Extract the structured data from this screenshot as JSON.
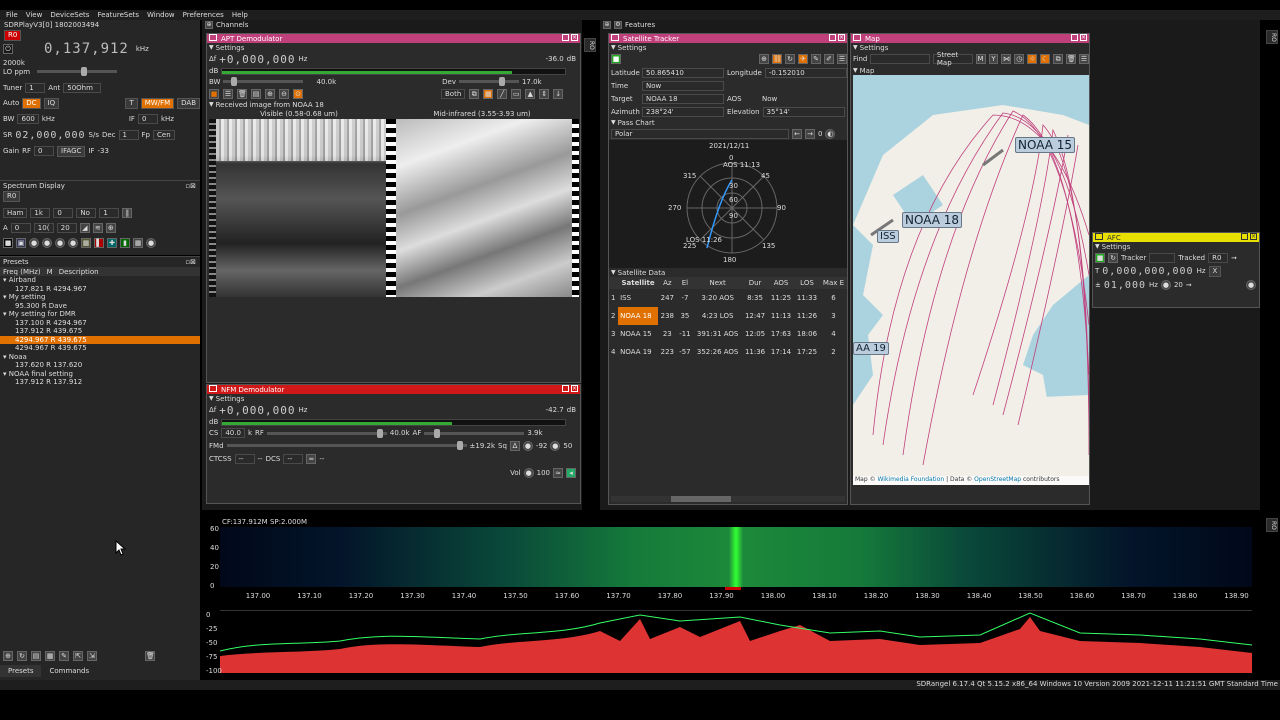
{
  "menu": [
    "File",
    "View",
    "DeviceSets",
    "FeatureSets",
    "Window",
    "Preferences",
    "Help"
  ],
  "device": {
    "title": "SDRPlayV3[0] 1802003494",
    "tag": "R0",
    "frequency": "0,137,912",
    "unit": "kHz",
    "sr": "2000k",
    "lo_ppm": "LO ppm",
    "tuner_label": "Tuner",
    "tuner_val": "1",
    "ant_label": "Ant",
    "ant_val": "50Ohm",
    "auto": "Auto",
    "dc": "DC",
    "iq": "IQ",
    "t": "T",
    "mwfm": "MW/FM",
    "dab": "DAB",
    "bw_label": "BW",
    "bw_val": "600",
    "bw_unit": "kHz",
    "if_label": "IF",
    "if_val": "0",
    "if_unit": "kHz",
    "sr_label": "SR",
    "sr_digits": "02,000,000",
    "sr_unit": "S/s",
    "dec_label": "Dec",
    "dec_val": "1",
    "fp_label": "Fp",
    "fp_val": "Cen",
    "gain_label": "Gain",
    "rf_label": "RF",
    "rf_val": "0",
    "ifagc": "IFAGC",
    "if2_label": "IF",
    "if2_val": "-33"
  },
  "spectrum_display": {
    "title": "Spectrum Display",
    "tag": "R0",
    "window": "Ham",
    "fft": "1k",
    "ovl": "0",
    "avg": "No",
    "avg_n": "1",
    "a": "A",
    "r1": "0",
    "r2": "10(",
    "r3": "20"
  },
  "presets": {
    "title": "Presets",
    "col1": "Freq (MHz)",
    "col2": "M",
    "col3": "Description",
    "items": [
      {
        "text": "Airband",
        "indent": 0,
        "group": true
      },
      {
        "text": "127.821  R  4294.967",
        "indent": 2,
        "group": false
      },
      {
        "text": "My setting",
        "indent": 0,
        "group": true
      },
      {
        "text": "95.300  R  Dave",
        "indent": 2,
        "group": false
      },
      {
        "text": "My setting for DMR",
        "indent": 0,
        "group": true
      },
      {
        "text": "137.100  R  4294.967",
        "indent": 2,
        "group": false
      },
      {
        "text": "137.912  R  439.675",
        "indent": 2,
        "group": false
      },
      {
        "text": "4294.967  R  439.675",
        "indent": 2,
        "group": false,
        "selected": true
      },
      {
        "text": "4294.967  R  439.675",
        "indent": 2,
        "group": false
      },
      {
        "text": "Noaa",
        "indent": 0,
        "group": true
      },
      {
        "text": "137.620  R  137.620",
        "indent": 2,
        "group": false
      },
      {
        "text": "NOAA final setting",
        "indent": 0,
        "group": true
      },
      {
        "text": "137.912  R  137.912",
        "indent": 2,
        "group": false
      }
    ],
    "tabs": [
      "Presets",
      "Commands"
    ]
  },
  "channels": {
    "title": "Channels"
  },
  "apt": {
    "title": "APT Demodulator",
    "settings": "Settings",
    "df": "Δf",
    "digits": "+0,000,000",
    "hz": "Hz",
    "db_val": "-36.0",
    "db": "dB",
    "bw": "BW",
    "bw_val": "40.0k",
    "dev": "Dev",
    "dev_val": "17.0k",
    "both": "Both",
    "image_section": "Received image from NOAA 18",
    "visible": "Visible (0.58-0.68 um)",
    "infrared": "Mid-infrared (3.55-3.93 um)"
  },
  "nfm": {
    "title": "NFM Demodulator",
    "settings": "Settings",
    "df": "Δf",
    "digits": "+0,000,000",
    "hz": "Hz",
    "db_val": "-42.7",
    "db": "dB",
    "cs": "CS",
    "cs_val": "40.0",
    "k": "k",
    "rf": "RF",
    "rf_val": "40.0k",
    "af": "AF",
    "af_val": "3.9k",
    "fmd": "FMd",
    "fmd_val": "±19.2k",
    "sq": "Sq",
    "sq_val": "-92",
    "ctcss": "CTCSS",
    "dcs": "DCS",
    "dash": "--",
    "vol": "Vol",
    "vol_val": "100",
    "sq_level": "50"
  },
  "features": {
    "title": "Features"
  },
  "sat": {
    "title": "Satellite Tracker",
    "settings": "Settings",
    "lat_label": "Latitude",
    "lat": "50.865410",
    "lon_label": "Longitude",
    "lon": "-0.152010",
    "time_label": "Time",
    "time": "Now",
    "target_label": "Target",
    "target": "NOAA 18",
    "aos_label": "AOS",
    "aos": "Now",
    "az_label": "Azimuth",
    "az": "238°24'",
    "el_label": "Elevation",
    "el": "35°14'",
    "pass_chart": "Pass Chart",
    "polar": "Polar",
    "date": "2021/12/11",
    "aos_time": "AOS 11:13",
    "los_time": "LOS 11:26",
    "chart_ticks": {
      "n": "0",
      "ne": "45",
      "e": "90",
      "se": "135",
      "s": "180",
      "sw": "225",
      "w": "270",
      "nw": "315",
      "r30": "30",
      "r60": "60",
      "r90": "90"
    },
    "data_title": "Satellite Data",
    "cols": [
      "Satellite",
      "Az",
      "El",
      "Next",
      "Dur",
      "AOS",
      "LOS",
      "Max E"
    ],
    "rows": [
      [
        "1",
        "ISS",
        "247",
        "-7",
        "3:20 AOS",
        "8:35",
        "11:25",
        "11:33",
        "6"
      ],
      [
        "2",
        "NOAA 18",
        "238",
        "35",
        "4:23 LOS",
        "12:47",
        "11:13",
        "11:26",
        "3"
      ],
      [
        "3",
        "NOAA 15",
        "23",
        "-11",
        "391:31 AOS",
        "12:05",
        "17:63",
        "18:06",
        "4"
      ],
      [
        "4",
        "NOAA 19",
        "223",
        "-57",
        "352:26 AOS",
        "11:36",
        "17:14",
        "17:25",
        "2"
      ]
    ]
  },
  "map": {
    "title": "Map",
    "settings": "Settings",
    "find": "Find",
    "style": "Street Map",
    "map_label": "Map",
    "labels": [
      "NOAA 15",
      "NOAA 18",
      "ISS",
      "AA 19"
    ],
    "attr1": "Map © ",
    "attr2": "Wikimedia Foundation",
    "attr3": " | Data © ",
    "attr4": "OpenStreetMap",
    "attr5": " contributors"
  },
  "afc": {
    "title": "AFC",
    "settings": "Settings",
    "tracker": "Tracker",
    "tracked": "Tracked",
    "tracked_val": "R0",
    "t": "T",
    "digits": "0,000,000,000",
    "hz": "Hz",
    "x": "X",
    "df": "±",
    "digits2": "01,000",
    "hz2": "Hz",
    "val": "20"
  },
  "spectrum": {
    "info": "CF:137.912M SP:2.000M",
    "waterfall_y": [
      "60",
      "40",
      "20",
      "0"
    ],
    "spec_y": [
      "0",
      "-25",
      "-50",
      "-75",
      "-100"
    ],
    "freqs": [
      "137.00",
      "137.10",
      "137.20",
      "137.30",
      "137.40",
      "137.50",
      "137.60",
      "137.70",
      "137.80",
      "137.90",
      "138.00",
      "138.10",
      "138.20",
      "138.30",
      "138.40",
      "138.50",
      "138.60",
      "138.70",
      "138.80",
      "138.90"
    ]
  },
  "status": "SDRangel 6.17.4 Qt 5.15.2 x86_64 Windows 10 Version 2009 2021-12-11 11:21:51 GMT Standard Time",
  "side_tags": {
    "ro1": "RO",
    "ro2": "RO",
    "ro3": "RO"
  }
}
